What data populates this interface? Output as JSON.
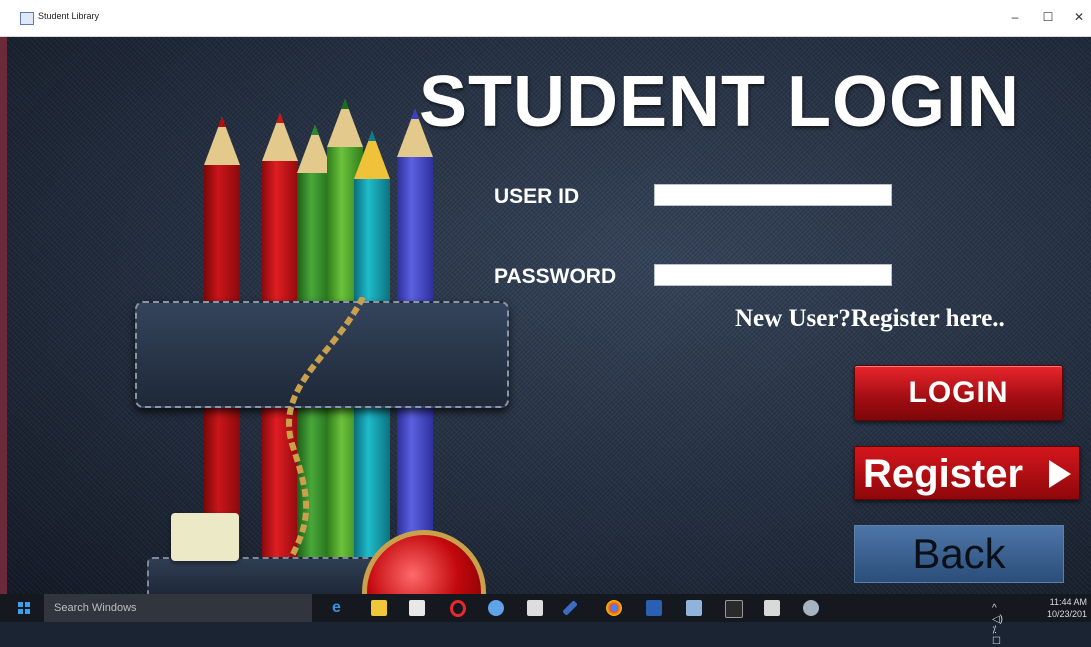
{
  "window": {
    "title": "Student Library",
    "minimize": "–",
    "maximize": "☐",
    "close": "✕"
  },
  "form": {
    "heading": "STUDENT LOGIN",
    "user_id_label": "USER ID",
    "user_id_value": "",
    "password_label": "PASSWORD",
    "password_value": "",
    "register_link": "New User?Register here..",
    "login_button": "LOGIN",
    "register_button": "Register",
    "back_button": "Back"
  },
  "taskbar": {
    "search_placeholder": "Search Windows",
    "time": "11:44 AM",
    "date": "10/23/201",
    "icons": [
      "edge-icon",
      "file-explorer-icon",
      "store-icon",
      "opera-icon",
      "app-icon",
      "camera-icon",
      "tool-icon",
      "chrome-icon",
      "word-icon",
      "app2-icon",
      "terminal-icon",
      "java-app-icon",
      "paint-icon"
    ]
  },
  "colors": {
    "login_red": "#b3151a",
    "back_blue": "#3b6393",
    "taskbar": "#15191f"
  }
}
